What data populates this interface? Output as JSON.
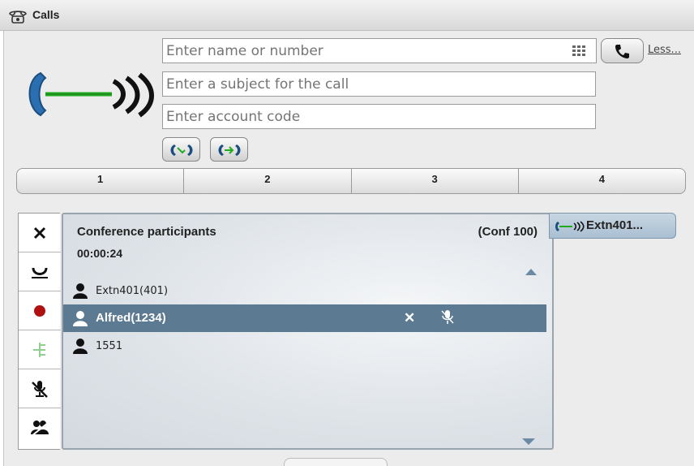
{
  "window": {
    "title": "Calls"
  },
  "dialer": {
    "name_placeholder": "Enter name or number",
    "subject_placeholder": "Enter a subject for the call",
    "account_placeholder": "Enter account code",
    "less_link": "Less...",
    "icons": {
      "keypad": "keypad-icon",
      "dial": "handset-icon",
      "transfer": "transfer-icon",
      "conference": "conference-icon"
    }
  },
  "tabs": [
    "1",
    "2",
    "3",
    "4"
  ],
  "toolbar": [
    "close-icon",
    "hold-icon",
    "record-icon",
    "conference-tree-icon",
    "mute-icon",
    "conference-all-icon"
  ],
  "conference": {
    "title": "Conference participants",
    "id": "(Conf 100)",
    "duration": "00:00:24",
    "participants": [
      {
        "name": "Extn401(401)",
        "selected": false
      },
      {
        "name": "Alfred(1234)",
        "selected": true
      },
      {
        "name": "1551",
        "selected": false
      }
    ]
  },
  "call_tab": {
    "label": "Extn401..."
  },
  "colors": {
    "selected_row": "#5c7a92",
    "call_green": "#22aa22",
    "call_tab": "#b8cadb"
  }
}
